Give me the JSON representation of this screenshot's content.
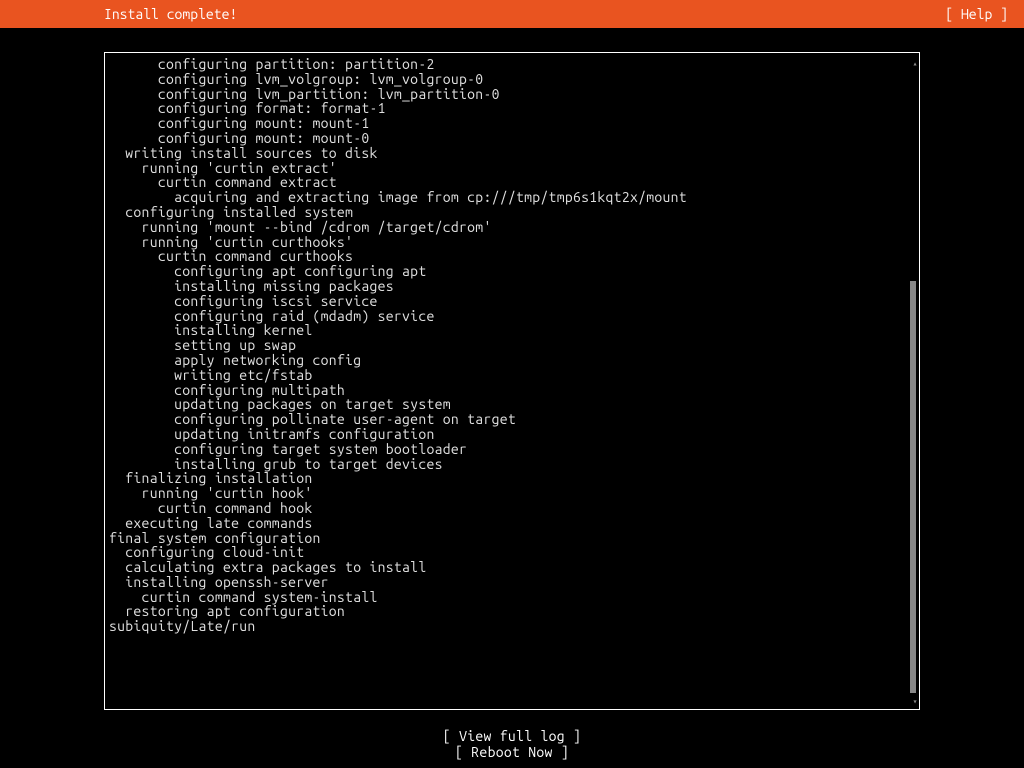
{
  "header": {
    "title": "Install complete!",
    "help": "[ Help ]"
  },
  "log_lines": [
    "      configuring partition: partition-2",
    "      configuring lvm_volgroup: lvm_volgroup-0",
    "      configuring lvm_partition: lvm_partition-0",
    "      configuring format: format-1",
    "      configuring mount: mount-1",
    "      configuring mount: mount-0",
    "  writing install sources to disk",
    "    running 'curtin extract'",
    "      curtin command extract",
    "        acquiring and extracting image from cp:///tmp/tmp6s1kqt2x/mount",
    "  configuring installed system",
    "    running 'mount --bind /cdrom /target/cdrom'",
    "    running 'curtin curthooks'",
    "      curtin command curthooks",
    "        configuring apt configuring apt",
    "        installing missing packages",
    "        configuring iscsi service",
    "        configuring raid (mdadm) service",
    "        installing kernel",
    "        setting up swap",
    "        apply networking config",
    "        writing etc/fstab",
    "        configuring multipath",
    "        updating packages on target system",
    "        configuring pollinate user-agent on target",
    "        updating initramfs configuration",
    "        configuring target system bootloader",
    "        installing grub to target devices",
    "  finalizing installation",
    "    running 'curtin hook'",
    "      curtin command hook",
    "  executing late commands",
    "final system configuration",
    "  configuring cloud-init",
    "  calculating extra packages to install",
    "  installing openssh-server",
    "    curtin command system-install",
    "  restoring apt configuration",
    "subiquity/Late/run"
  ],
  "buttons": {
    "view_log": "[ View full log ]",
    "reboot": "[ Reboot Now    ]"
  }
}
